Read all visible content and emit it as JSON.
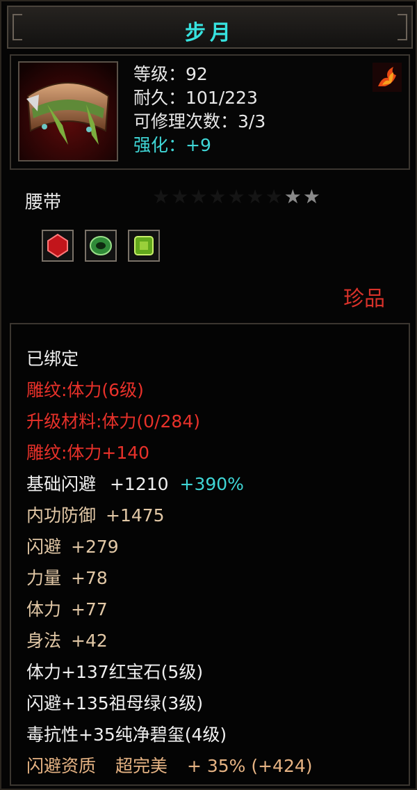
{
  "title": "步月",
  "stats": {
    "level_label": "等级：",
    "level": "92",
    "durability_label": "耐久：",
    "durability": "101/223",
    "repairs_label": "可修理次数：",
    "repairs": "3/3",
    "enhance_label": "强化：",
    "enhance": "+9"
  },
  "item_type": "腰带",
  "stars": {
    "total": 9,
    "lit": 2,
    "char": "★"
  },
  "quality": "珍品",
  "bound": "已绑定",
  "engrave_lines": [
    "雕纹:体力(6级)",
    "升级材料:体力(0/284)",
    "雕纹:体力+140"
  ],
  "base_dodge": {
    "label": "基础闪避",
    "value": "+1210",
    "pct": "+390%"
  },
  "attrs": [
    {
      "label": "内功防御",
      "value": "+1475"
    },
    {
      "label": "闪避",
      "value": "+279"
    },
    {
      "label": "力量",
      "value": "+78"
    },
    {
      "label": "体力",
      "value": "+77"
    },
    {
      "label": "身法",
      "value": "+42"
    }
  ],
  "gem_lines": [
    "体力+137红宝石(5级)",
    "闪避+135祖母绿(3级)",
    "毒抗性+35纯净碧玺(4级)"
  ],
  "aptitude": {
    "label": "闪避资质",
    "grade": "超完美",
    "value": "+ 35% (+424)"
  },
  "colors": {
    "title": "#37e2df",
    "enhance": "#3fd6d6",
    "red": "#e8312a",
    "gold": "#e2c8a6"
  }
}
